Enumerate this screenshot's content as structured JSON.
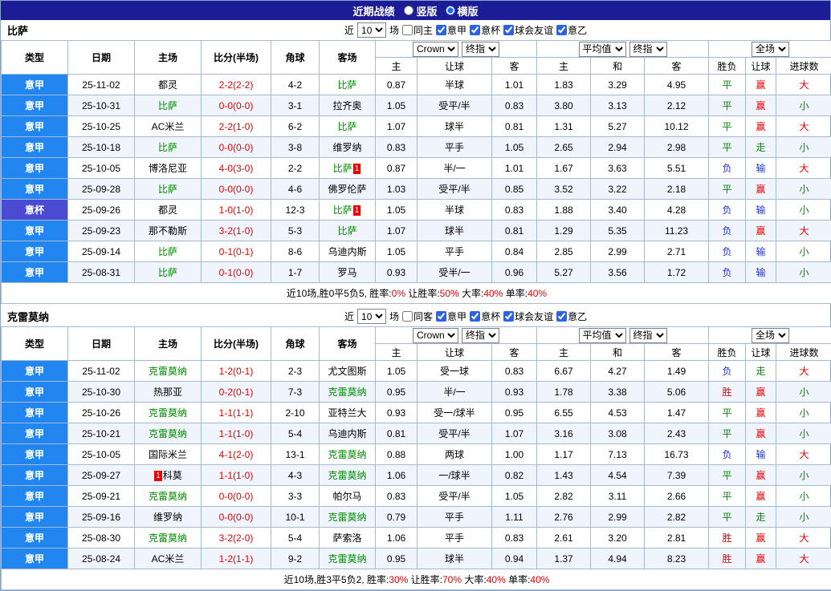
{
  "colors": {
    "titlebar_bg": "#1c1c96",
    "league_main": "#2186f0",
    "league_cup": "#4a4ad2",
    "accent_red": "#e60000",
    "accent_green": "#008a00",
    "accent_blue": "#2233cc",
    "row_alt": "#f0f4fc",
    "border": "#a6bad6"
  },
  "header": {
    "title": "近期战绩",
    "layout_options": [
      {
        "label": "竖版",
        "checked": false
      },
      {
        "label": "横版",
        "checked": true
      }
    ]
  },
  "sections": [
    {
      "team": "比萨",
      "filter": {
        "near_label": "近",
        "count": "10",
        "games_label": "场",
        "same_label": "同主",
        "same_checked": false,
        "leagues": [
          {
            "label": "意甲",
            "checked": true
          },
          {
            "label": "意杯",
            "checked": true
          },
          {
            "label": "球会友谊",
            "checked": true
          },
          {
            "label": "意乙",
            "checked": true
          }
        ]
      },
      "table": {
        "col_headers": [
          "类型",
          "日期",
          "主场",
          "比分(半场)",
          "角球",
          "客场"
        ],
        "dropdowns": {
          "crow": "Crown",
          "final1": "终指",
          "avg": "平均值",
          "final2": "终指",
          "full": "全场"
        },
        "sub_headers": [
          "主",
          "让球",
          "客",
          "主",
          "和",
          "客",
          "胜负",
          "让球",
          "进球数"
        ],
        "rows": [
          {
            "league": "意甲",
            "date": "25-11-02",
            "home": {
              "text": "都灵",
              "focus": false
            },
            "score": "2-2(2-2)",
            "corner": "4-2",
            "away": {
              "text": "比萨",
              "focus": true
            },
            "odds": [
              "0.87",
              "半球",
              "1.01",
              "1.83",
              "3.29",
              "4.95"
            ],
            "result": "平",
            "handicap": "赢",
            "goals": "大"
          },
          {
            "league": "意甲",
            "date": "25-10-31",
            "home": {
              "text": "比萨",
              "focus": true
            },
            "score": "0-0(0-0)",
            "corner": "3-1",
            "away": {
              "text": "拉齐奥",
              "focus": false
            },
            "odds": [
              "1.05",
              "受平/半",
              "0.83",
              "3.80",
              "3.13",
              "2.12"
            ],
            "result": "平",
            "handicap": "赢",
            "goals": "小"
          },
          {
            "league": "意甲",
            "date": "25-10-25",
            "home": {
              "text": "AC米兰",
              "focus": false
            },
            "score": "2-2(1-0)",
            "corner": "6-2",
            "away": {
              "text": "比萨",
              "focus": true
            },
            "odds": [
              "1.07",
              "球半",
              "0.81",
              "1.31",
              "5.27",
              "10.12"
            ],
            "result": "平",
            "handicap": "赢",
            "goals": "大"
          },
          {
            "league": "意甲",
            "date": "25-10-18",
            "home": {
              "text": "比萨",
              "focus": true
            },
            "score": "0-0(0-0)",
            "corner": "3-8",
            "away": {
              "text": "维罗纳",
              "focus": false
            },
            "odds": [
              "0.83",
              "平手",
              "1.05",
              "2.65",
              "2.94",
              "2.98"
            ],
            "result": "平",
            "handicap": "走",
            "goals": "小"
          },
          {
            "league": "意甲",
            "date": "25-10-05",
            "home": {
              "text": "博洛尼亚",
              "focus": false
            },
            "score": "4-0(3-0)",
            "corner": "2-2",
            "away": {
              "text": "比萨",
              "focus": true,
              "badge": "1",
              "badge_pos": "after"
            },
            "odds": [
              "0.87",
              "半/一",
              "1.01",
              "1.67",
              "3.63",
              "5.51"
            ],
            "result": "负",
            "handicap": "输",
            "goals": "大"
          },
          {
            "league": "意甲",
            "date": "25-09-28",
            "home": {
              "text": "比萨",
              "focus": true
            },
            "score": "0-0(0-0)",
            "corner": "4-6",
            "away": {
              "text": "佛罗伦萨",
              "focus": false
            },
            "odds": [
              "1.03",
              "受平/半",
              "0.85",
              "3.52",
              "3.22",
              "2.18"
            ],
            "result": "平",
            "handicap": "赢",
            "goals": "小"
          },
          {
            "league": "意杯",
            "date": "25-09-26",
            "home": {
              "text": "都灵",
              "focus": false
            },
            "score": "1-0(1-0)",
            "corner": "12-3",
            "away": {
              "text": "比萨",
              "focus": true,
              "badge": "1",
              "badge_pos": "after"
            },
            "odds": [
              "1.05",
              "半球",
              "0.83",
              "1.88",
              "3.40",
              "4.28"
            ],
            "result": "负",
            "handicap": "输",
            "goals": "小"
          },
          {
            "league": "意甲",
            "date": "25-09-23",
            "home": {
              "text": "那不勒斯",
              "focus": false
            },
            "score": "3-2(1-0)",
            "corner": "5-3",
            "away": {
              "text": "比萨",
              "focus": true
            },
            "odds": [
              "1.07",
              "球半",
              "0.81",
              "1.29",
              "5.35",
              "11.23"
            ],
            "result": "负",
            "handicap": "赢",
            "goals": "大"
          },
          {
            "league": "意甲",
            "date": "25-09-14",
            "home": {
              "text": "比萨",
              "focus": true
            },
            "score": "0-1(0-1)",
            "corner": "8-6",
            "away": {
              "text": "乌迪内斯",
              "focus": false
            },
            "odds": [
              "1.05",
              "平手",
              "0.84",
              "2.85",
              "2.99",
              "2.71"
            ],
            "result": "负",
            "handicap": "输",
            "goals": "小"
          },
          {
            "league": "意甲",
            "date": "25-08-31",
            "home": {
              "text": "比萨",
              "focus": true
            },
            "score": "0-1(0-0)",
            "corner": "1-7",
            "away": {
              "text": "罗马",
              "focus": false
            },
            "odds": [
              "0.93",
              "受半/一",
              "0.96",
              "5.27",
              "3.56",
              "1.72"
            ],
            "result": "负",
            "handicap": "输",
            "goals": "小"
          }
        ]
      },
      "summary": [
        {
          "text": "近10场,胜0平5负5, 胜率:",
          "red": false
        },
        {
          "text": "0%",
          "red": true
        },
        {
          "text": " 让胜率:",
          "red": false
        },
        {
          "text": "50%",
          "red": true
        },
        {
          "text": " 大率:",
          "red": false
        },
        {
          "text": "40%",
          "red": true
        },
        {
          "text": " 单率:",
          "red": false
        },
        {
          "text": "40%",
          "red": true
        }
      ]
    },
    {
      "team": "克雷莫纳",
      "filter": {
        "near_label": "近",
        "count": "10",
        "games_label": "场",
        "same_label": "同客",
        "same_checked": false,
        "leagues": [
          {
            "label": "意甲",
            "checked": true
          },
          {
            "label": "意杯",
            "checked": true
          },
          {
            "label": "球会友谊",
            "checked": true
          },
          {
            "label": "意乙",
            "checked": true
          }
        ]
      },
      "table": {
        "col_headers": [
          "类型",
          "日期",
          "主场",
          "比分(半场)",
          "角球",
          "客场"
        ],
        "dropdowns": {
          "crow": "Crown",
          "final1": "终指",
          "avg": "平均值",
          "final2": "终指",
          "full": "全场"
        },
        "sub_headers": [
          "主",
          "让球",
          "客",
          "主",
          "和",
          "客",
          "胜负",
          "让球",
          "进球数"
        ],
        "rows": [
          {
            "league": "意甲",
            "date": "25-11-02",
            "home": {
              "text": "克雷莫纳",
              "focus": true
            },
            "score": "1-2(0-1)",
            "corner": "2-3",
            "away": {
              "text": "尤文图斯",
              "focus": false
            },
            "odds": [
              "1.05",
              "受一球",
              "0.83",
              "6.67",
              "4.27",
              "1.49"
            ],
            "result": "负",
            "handicap": "走",
            "goals": "大"
          },
          {
            "league": "意甲",
            "date": "25-10-30",
            "home": {
              "text": "热那亚",
              "focus": false
            },
            "score": "0-2(0-1)",
            "corner": "7-3",
            "away": {
              "text": "克雷莫纳",
              "focus": true
            },
            "odds": [
              "0.95",
              "半/一",
              "0.93",
              "1.78",
              "3.38",
              "5.06"
            ],
            "result": "胜",
            "handicap": "赢",
            "goals": "小"
          },
          {
            "league": "意甲",
            "date": "25-10-26",
            "home": {
              "text": "克雷莫纳",
              "focus": true
            },
            "score": "1-1(1-1)",
            "corner": "2-10",
            "away": {
              "text": "亚特兰大",
              "focus": false
            },
            "odds": [
              "0.93",
              "受一/球半",
              "0.95",
              "6.55",
              "4.53",
              "1.47"
            ],
            "result": "平",
            "handicap": "赢",
            "goals": "小"
          },
          {
            "league": "意甲",
            "date": "25-10-21",
            "home": {
              "text": "克雷莫纳",
              "focus": true
            },
            "score": "1-1(1-0)",
            "corner": "5-4",
            "away": {
              "text": "乌迪内斯",
              "focus": false
            },
            "odds": [
              "0.81",
              "受平/半",
              "1.07",
              "3.16",
              "3.08",
              "2.43"
            ],
            "result": "平",
            "handicap": "赢",
            "goals": "小"
          },
          {
            "league": "意甲",
            "date": "25-10-05",
            "home": {
              "text": "国际米兰",
              "focus": false
            },
            "score": "4-1(2-0)",
            "corner": "13-1",
            "away": {
              "text": "克雷莫纳",
              "focus": true
            },
            "odds": [
              "0.88",
              "两球",
              "1.00",
              "1.17",
              "7.13",
              "16.73"
            ],
            "result": "负",
            "handicap": "输",
            "goals": "大"
          },
          {
            "league": "意甲",
            "date": "25-09-27",
            "home": {
              "text": "科莫",
              "focus": false,
              "badge": "1",
              "badge_pos": "before"
            },
            "score": "1-1(1-0)",
            "corner": "4-3",
            "away": {
              "text": "克雷莫纳",
              "focus": true
            },
            "odds": [
              "1.06",
              "一/球半",
              "0.82",
              "1.43",
              "4.54",
              "7.39"
            ],
            "result": "平",
            "handicap": "赢",
            "goals": "小"
          },
          {
            "league": "意甲",
            "date": "25-09-21",
            "home": {
              "text": "克雷莫纳",
              "focus": true
            },
            "score": "0-0(0-0)",
            "corner": "3-3",
            "away": {
              "text": "帕尔马",
              "focus": false
            },
            "odds": [
              "0.83",
              "受平/半",
              "1.05",
              "2.82",
              "3.11",
              "2.66"
            ],
            "result": "平",
            "handicap": "赢",
            "goals": "小"
          },
          {
            "league": "意甲",
            "date": "25-09-16",
            "home": {
              "text": "维罗纳",
              "focus": false
            },
            "score": "0-0(0-0)",
            "corner": "10-1",
            "away": {
              "text": "克雷莫纳",
              "focus": true
            },
            "odds": [
              "0.79",
              "平手",
              "1.11",
              "2.76",
              "2.99",
              "2.82"
            ],
            "result": "平",
            "handicap": "走",
            "goals": "小"
          },
          {
            "league": "意甲",
            "date": "25-08-30",
            "home": {
              "text": "克雷莫纳",
              "focus": true
            },
            "score": "3-2(2-0)",
            "corner": "5-4",
            "away": {
              "text": "萨索洛",
              "focus": false
            },
            "odds": [
              "1.06",
              "平手",
              "0.83",
              "2.61",
              "3.20",
              "2.81"
            ],
            "result": "胜",
            "handicap": "赢",
            "goals": "大"
          },
          {
            "league": "意甲",
            "date": "25-08-24",
            "home": {
              "text": "AC米兰",
              "focus": false
            },
            "score": "1-2(1-1)",
            "corner": "9-2",
            "away": {
              "text": "克雷莫纳",
              "focus": true
            },
            "odds": [
              "0.95",
              "球半",
              "0.94",
              "1.37",
              "4.94",
              "8.23"
            ],
            "result": "胜",
            "handicap": "赢",
            "goals": "大"
          }
        ]
      },
      "summary": [
        {
          "text": "近10场,胜3平5负2, 胜率:",
          "red": false
        },
        {
          "text": "30%",
          "red": true
        },
        {
          "text": " 让胜率:",
          "red": false
        },
        {
          "text": "70%",
          "red": true
        },
        {
          "text": " 大率:",
          "red": false
        },
        {
          "text": "40%",
          "red": true
        },
        {
          "text": " 单率:",
          "red": false
        },
        {
          "text": "40%",
          "red": true
        }
      ]
    }
  ]
}
